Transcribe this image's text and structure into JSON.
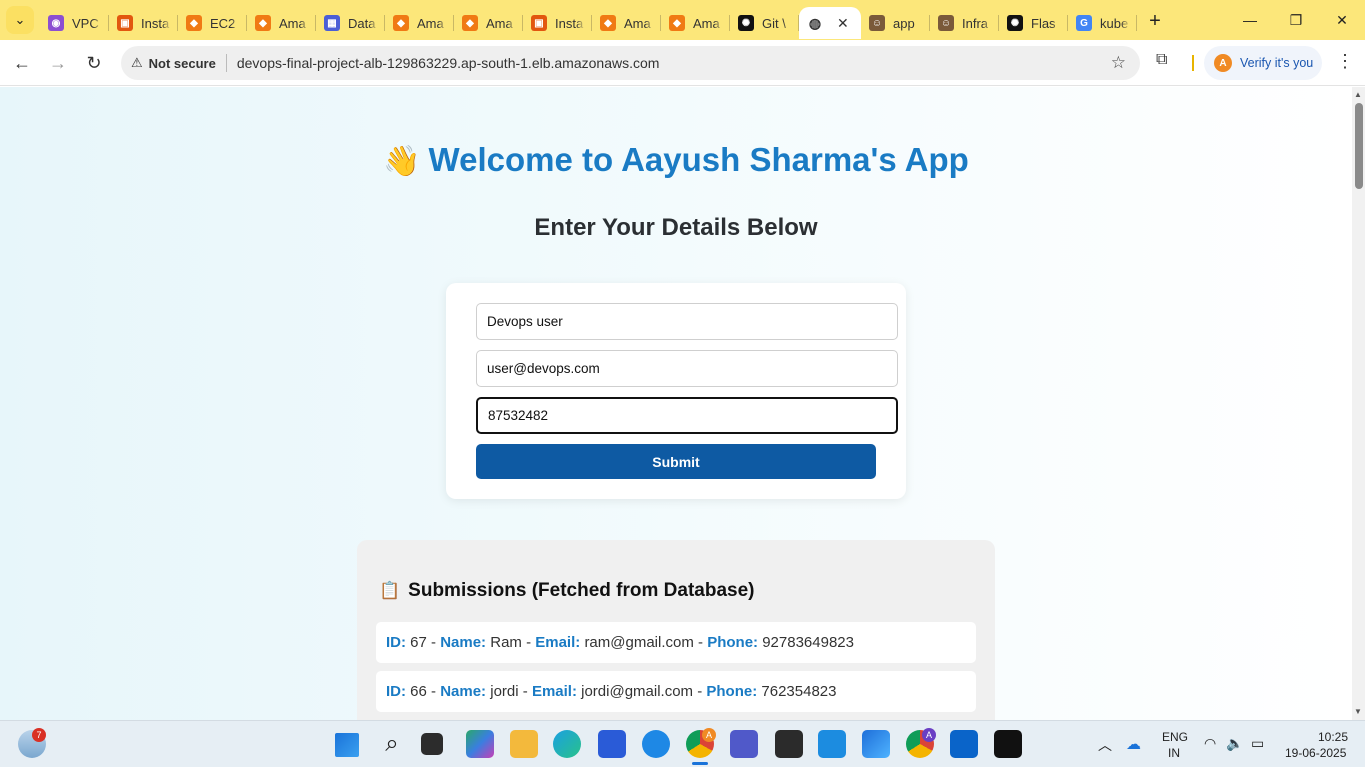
{
  "browser": {
    "tabs": [
      {
        "label": "VPC",
        "icon": "vpc-icon",
        "color": "#8c4fd1",
        "glyph": "◉"
      },
      {
        "label": "Insta",
        "icon": "aws-service-icon",
        "color": "#e2570f",
        "glyph": "▣"
      },
      {
        "label": "EC2",
        "icon": "aws-cube-icon",
        "color": "#f07a14",
        "glyph": "◆"
      },
      {
        "label": "Ama",
        "icon": "aws-cube-icon",
        "color": "#f07a14",
        "glyph": "◆"
      },
      {
        "label": "Data",
        "icon": "database-icon",
        "color": "#4b5fd6",
        "glyph": "▦"
      },
      {
        "label": "Ama",
        "icon": "aws-cube-icon",
        "color": "#f07a14",
        "glyph": "◆"
      },
      {
        "label": "Ama",
        "icon": "aws-cube-icon",
        "color": "#f07a14",
        "glyph": "◆"
      },
      {
        "label": "Insta",
        "icon": "aws-service-icon",
        "color": "#e2570f",
        "glyph": "▣"
      },
      {
        "label": "Ama",
        "icon": "aws-cube-icon",
        "color": "#f07a14",
        "glyph": "◆"
      },
      {
        "label": "Ama",
        "icon": "aws-cube-icon",
        "color": "#f07a14",
        "glyph": "◆"
      },
      {
        "label": "Git \\",
        "icon": "openai-icon",
        "color": "#111111",
        "glyph": "✺"
      }
    ],
    "active_tab": {
      "label": "",
      "icon": "globe-icon",
      "close": "✕"
    },
    "tabs_after": [
      {
        "label": "app",
        "icon": "person-icon",
        "color": "#7a5a3a",
        "glyph": "☺"
      },
      {
        "label": "Infra",
        "icon": "person-icon",
        "color": "#7a5a3a",
        "glyph": "☺"
      },
      {
        "label": "Flas",
        "icon": "openai-icon",
        "color": "#111111",
        "glyph": "✺"
      },
      {
        "label": "kube",
        "icon": "google-icon",
        "color": "#4285f4",
        "glyph": "G"
      }
    ],
    "new_tab": "+",
    "not_secure": "Not secure",
    "url": "devops-final-project-alb-129863229.ap-south-1.elb.amazonaws.com",
    "verify_label": "Verify it's you",
    "profile_initial": "A"
  },
  "page": {
    "wave": "👋",
    "title": "Welcome to Aayush Sharma's App",
    "subtitle": "Enter Your Details Below",
    "form": {
      "name_value": "Devops user",
      "email_value": "user@devops.com",
      "phone_value": "87532482",
      "submit_label": "Submit"
    },
    "submissions": {
      "clip": "📋",
      "title": "Submissions (Fetched from Database)",
      "id_key": "ID:",
      "name_key": "Name:",
      "email_key": "Email:",
      "phone_key": "Phone:",
      "sep": " - ",
      "rows": [
        {
          "id": "67",
          "name": "Ram",
          "email": "ram@gmail.com",
          "phone": "92783649823"
        },
        {
          "id": "66",
          "name": "jordi",
          "email": "jordi@gmail.com",
          "phone": "762354823"
        }
      ]
    }
  },
  "taskbar": {
    "weather_badge": "7",
    "lang": "ENG",
    "region": "IN",
    "time": "10:25",
    "date": "19-06-2025",
    "chrome_badge": "A",
    "chrome2_badge": "A"
  }
}
